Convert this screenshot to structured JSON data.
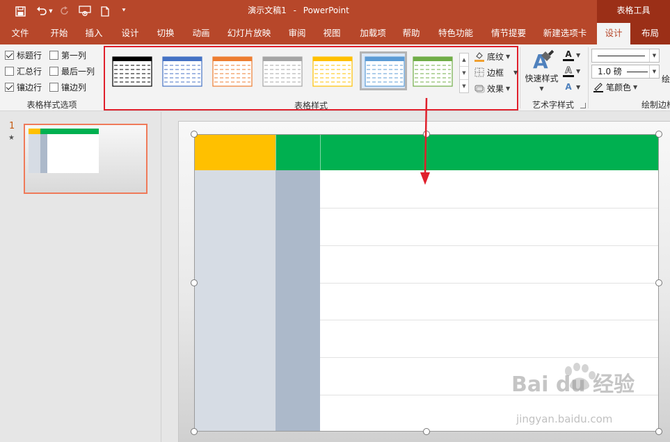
{
  "window": {
    "doc_name": "演示文稿1",
    "separator": "-",
    "app_name": "PowerPoint",
    "contextual_group": "表格工具"
  },
  "tabs": [
    {
      "label": "文件"
    },
    {
      "label": "开始"
    },
    {
      "label": "插入"
    },
    {
      "label": "设计"
    },
    {
      "label": "切换"
    },
    {
      "label": "动画"
    },
    {
      "label": "幻灯片放映"
    },
    {
      "label": "审阅"
    },
    {
      "label": "视图"
    },
    {
      "label": "加载项"
    },
    {
      "label": "帮助"
    },
    {
      "label": "特色功能"
    },
    {
      "label": "情节提要"
    },
    {
      "label": "新建选项卡"
    },
    {
      "label": "设计"
    },
    {
      "label": "布局"
    }
  ],
  "style_options": {
    "group_label": "表格样式选项",
    "items": [
      {
        "label": "标题行",
        "checked": true
      },
      {
        "label": "第一列",
        "checked": false
      },
      {
        "label": "汇总行",
        "checked": false
      },
      {
        "label": "最后一列",
        "checked": false
      },
      {
        "label": "镶边行",
        "checked": true
      },
      {
        "label": "镶边列",
        "checked": false
      }
    ]
  },
  "table_styles": {
    "group_label": "表格样式",
    "styles": [
      {
        "name": "black",
        "color": "#000000"
      },
      {
        "name": "blue",
        "color": "#4472c4"
      },
      {
        "name": "orange",
        "color": "#ed7d31"
      },
      {
        "name": "gray",
        "color": "#a5a5a5"
      },
      {
        "name": "gold",
        "color": "#ffc000"
      },
      {
        "name": "light-blue",
        "color": "#5b9bd5",
        "selected": true
      },
      {
        "name": "green",
        "color": "#70ad47"
      }
    ],
    "shading_label": "底纹",
    "borders_label": "边框",
    "effects_label": "效果"
  },
  "wordart": {
    "group_label": "艺术字样式",
    "quick_styles_label": "快速样式",
    "letter": "A"
  },
  "draw_borders": {
    "group_label": "绘制边框",
    "pen_weight": "1.0 磅",
    "pen_color_label": "笔颜色",
    "cut_label": "绘"
  },
  "slides_pane": {
    "slide_number": "1",
    "star": "★"
  },
  "colors": {
    "brand": "#b7472a",
    "contextual": "#9b2f17",
    "header_first": "#ffc000",
    "header_rest": "#00b050",
    "col1_fill": "#d6dce4",
    "col2_fill": "#acb9ca",
    "highlight": "#e0202c"
  },
  "table": {
    "rows": 8,
    "columns": 3
  },
  "watermark": {
    "text": "Bai du 经验",
    "url": "jingyan.baidu.com"
  }
}
